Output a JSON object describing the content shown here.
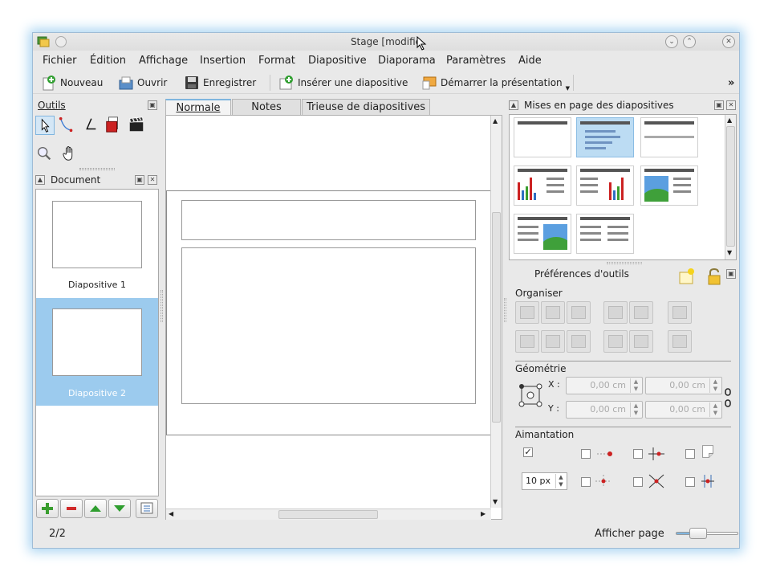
{
  "window": {
    "title": "Stage [modifié]",
    "title_visible": "Stage [modifie"
  },
  "menu": [
    "Fichier",
    "Édition",
    "Affichage",
    "Insertion",
    "Format",
    "Diapositive",
    "Diaporama",
    "Paramètres",
    "Aide"
  ],
  "toolbar": {
    "new": "Nouveau",
    "open": "Ouvrir",
    "save": "Enregistrer",
    "insert_slide": "Insérer une diapositive",
    "start_presentation": "Démarrer la présentation",
    "more": "»"
  },
  "tools_dock": {
    "title": "Outils"
  },
  "document_dock": {
    "title": "Document",
    "slides": [
      {
        "label": "Diapositive 1",
        "selected": false
      },
      {
        "label": "Diapositive 2",
        "selected": true
      }
    ]
  },
  "tabs": [
    {
      "label": "Normale",
      "active": true
    },
    {
      "label": "Notes",
      "active": false
    },
    {
      "label": "Trieuse de diapositives",
      "active": false
    }
  ],
  "layouts_dock": {
    "title": "Mises en page des diapositives"
  },
  "tool_options": {
    "title": "Préférences d'outils",
    "arrange_label": "Organiser",
    "geometry_label": "Géométrie",
    "x_label": "X :",
    "y_label": "Y :",
    "x_value": "0,00 cm",
    "y_value": "0,00 cm",
    "w_value": "0,00 cm",
    "h_value": "0,00 cm",
    "snap_label": "Aimantation",
    "snap_distance": "10 px"
  },
  "status": {
    "page": "2/2",
    "show_page": "Afficher page"
  },
  "colors": {
    "selection": "#9ccbee",
    "accent": "#7fb5df"
  }
}
